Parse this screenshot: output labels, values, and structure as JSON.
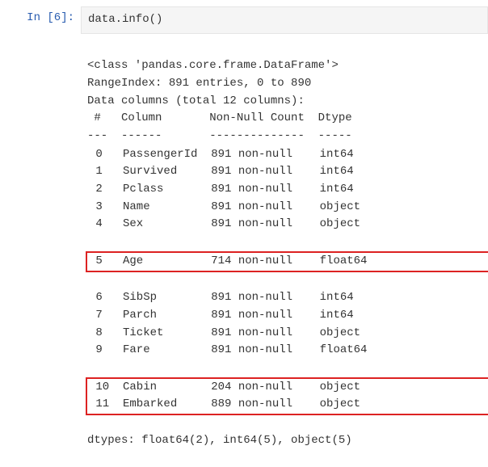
{
  "prompt": {
    "label": "In ",
    "count": "[6]:"
  },
  "input": {
    "expr": "data.info()"
  },
  "output": {
    "class_line": "<class 'pandas.core.frame.DataFrame'>",
    "range_line": "RangeIndex: 891 entries, 0 to 890",
    "cols_line": "Data columns (total 12 columns):",
    "header": " #   Column       Non-Null Count  Dtype  ",
    "divider": "---  ------       --------------  -----  ",
    "rows": [
      {
        "idx": " 0",
        "col": "PassengerId",
        "nn": "891 non-null",
        "dtype": "int64",
        "hl": false
      },
      {
        "idx": " 1",
        "col": "Survived",
        "nn": "891 non-null",
        "dtype": "int64",
        "hl": false
      },
      {
        "idx": " 2",
        "col": "Pclass",
        "nn": "891 non-null",
        "dtype": "int64",
        "hl": false
      },
      {
        "idx": " 3",
        "col": "Name",
        "nn": "891 non-null",
        "dtype": "object",
        "hl": false
      },
      {
        "idx": " 4",
        "col": "Sex",
        "nn": "891 non-null",
        "dtype": "object",
        "hl": false
      },
      {
        "idx": " 5",
        "col": "Age",
        "nn": "714 non-null",
        "dtype": "float64",
        "hl": true
      },
      {
        "idx": " 6",
        "col": "SibSp",
        "nn": "891 non-null",
        "dtype": "int64",
        "hl": false
      },
      {
        "idx": " 7",
        "col": "Parch",
        "nn": "891 non-null",
        "dtype": "int64",
        "hl": false
      },
      {
        "idx": " 8",
        "col": "Ticket",
        "nn": "891 non-null",
        "dtype": "object",
        "hl": false
      },
      {
        "idx": " 9",
        "col": "Fare",
        "nn": "891 non-null",
        "dtype": "float64",
        "hl": false
      },
      {
        "idx": " 10",
        "col": "Cabin",
        "nn": "204 non-null",
        "dtype": "object",
        "hl": true
      },
      {
        "idx": " 11",
        "col": "Embarked",
        "nn": "889 non-null",
        "dtype": "object",
        "hl": true
      }
    ],
    "dtypes_line": "dtypes: float64(2), int64(5), object(5)"
  },
  "chart_data": {
    "type": "table",
    "title": "pandas DataFrame.info() output",
    "header": [
      "#",
      "Column",
      "Non-Null Count",
      "Dtype"
    ],
    "rows": [
      [
        0,
        "PassengerId",
        "891 non-null",
        "int64"
      ],
      [
        1,
        "Survived",
        "891 non-null",
        "int64"
      ],
      [
        2,
        "Pclass",
        "891 non-null",
        "int64"
      ],
      [
        3,
        "Name",
        "891 non-null",
        "object"
      ],
      [
        4,
        "Sex",
        "891 non-null",
        "object"
      ],
      [
        5,
        "Age",
        "714 non-null",
        "float64"
      ],
      [
        6,
        "SibSp",
        "891 non-null",
        "int64"
      ],
      [
        7,
        "Parch",
        "891 non-null",
        "int64"
      ],
      [
        8,
        "Ticket",
        "891 non-null",
        "object"
      ],
      [
        9,
        "Fare",
        "891 non-null",
        "float64"
      ],
      [
        10,
        "Cabin",
        "204 non-null",
        "object"
      ],
      [
        11,
        "Embarked",
        "889 non-null",
        "object"
      ]
    ],
    "range_index": {
      "entries": 891,
      "from": 0,
      "to": 890
    },
    "total_columns": 12,
    "dtypes_summary": {
      "float64": 2,
      "int64": 5,
      "object": 5
    }
  }
}
